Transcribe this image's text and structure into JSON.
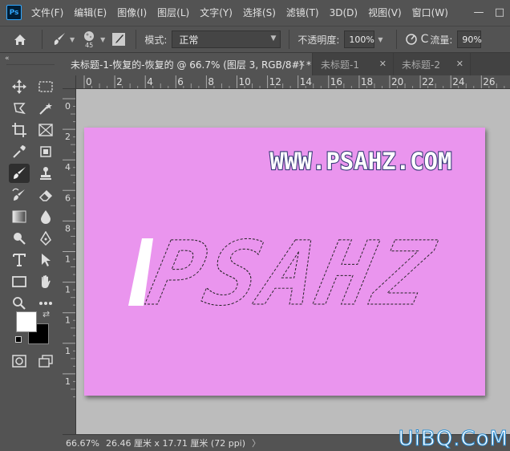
{
  "menu": {
    "logo": "Ps",
    "items": [
      "文件(F)",
      "编辑(E)",
      "图像(I)",
      "图层(L)",
      "文字(Y)",
      "选择(S)",
      "滤镜(T)",
      "3D(D)",
      "视图(V)",
      "窗口(W)"
    ],
    "controls": [
      "—",
      "□"
    ]
  },
  "options": {
    "brush_size": "45",
    "mode_label": "模式:",
    "mode_value": "正常",
    "opacity_label": "不透明度:",
    "opacity_value": "100%",
    "flow_label": "流量:",
    "flow_value": "90%"
  },
  "tabs": [
    {
      "label": "未标题-1-恢复的-恢复的 @ 66.7% (图层 3, RGB/8#) *",
      "active": true
    },
    {
      "label": "未标题-1",
      "active": false
    },
    {
      "label": "未标题-2",
      "active": false
    }
  ],
  "ruler": {
    "h_ticks": [
      "0",
      "2",
      "4",
      "6",
      "8",
      "10",
      "12",
      "14",
      "16",
      "18",
      "20",
      "22",
      "24",
      "26"
    ],
    "v_ticks": [
      "0",
      "2",
      "4",
      "6",
      "8",
      "1",
      "1",
      "1",
      "1",
      "1"
    ]
  },
  "canvas": {
    "background_color": "#ea95ee",
    "site_text": "WWW.PSAHZ.COM",
    "big_text": "PSAHZ"
  },
  "status": {
    "zoom": "66.67%",
    "doc_info": "26.46 厘米 x 17.71 厘米 (72 ppi)",
    "arrow": "〉"
  },
  "watermark": "UiBQ.CoM",
  "tools": [
    "move-icon",
    "marquee-icon",
    "lasso-icon",
    "magic-wand-icon",
    "crop-icon",
    "frame-icon",
    "eyedropper-icon",
    "ruler-tool-icon",
    "brush-icon",
    "stamp-icon",
    "history-brush-icon",
    "eraser-icon",
    "gradient-icon",
    "blur-icon",
    "dodge-icon",
    "pen-icon",
    "type-icon",
    "path-select-icon",
    "rectangle-icon",
    "hand-icon",
    "zoom-icon",
    "more-icon"
  ]
}
